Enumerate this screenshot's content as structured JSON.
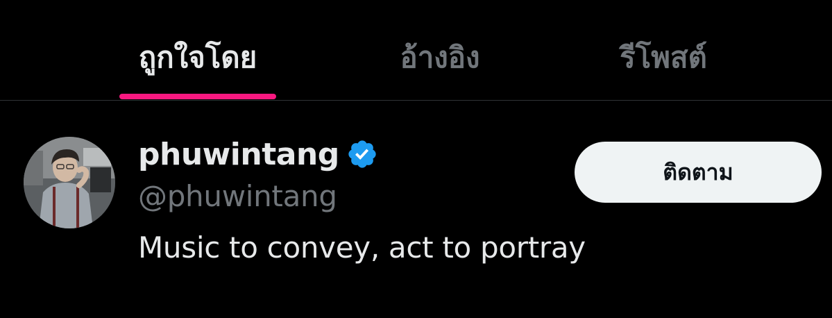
{
  "tabs": [
    {
      "label": "ถูกใจโดย",
      "active": true
    },
    {
      "label": "อ้างอิง",
      "active": false
    },
    {
      "label": "รีโพสต์",
      "active": false
    }
  ],
  "colors": {
    "background": "#000000",
    "accent": "#f91880",
    "verified": "#1d9bf0",
    "muted_text": "#71767b",
    "primary_text": "#e7e9ea",
    "button_bg": "#eff3f4"
  },
  "user": {
    "display_name": "phuwintang",
    "handle": "@phuwintang",
    "bio": "Music to convey, act to portray",
    "verified": true,
    "verified_icon": "verified-badge-icon",
    "follow_label": "ติดตาม"
  }
}
